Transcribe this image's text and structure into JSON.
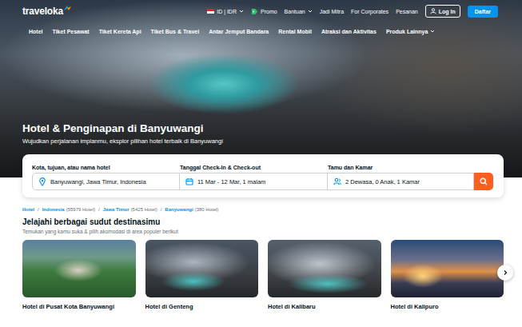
{
  "header": {
    "logo": "traveloka",
    "locale": "ID | IDR",
    "links": [
      {
        "label": "Promo",
        "kind": "promo"
      },
      {
        "label": "Bantuan",
        "kind": "dropdown"
      },
      {
        "label": "Jadi Mitra",
        "kind": "plain"
      },
      {
        "label": "For Corporates",
        "kind": "plain"
      },
      {
        "label": "Pesanan",
        "kind": "plain"
      }
    ],
    "login": "Log In",
    "register": "Daftar"
  },
  "nav": [
    {
      "label": "Hotel",
      "dropdown": false
    },
    {
      "label": "Tiket Pesawat",
      "dropdown": false
    },
    {
      "label": "Tiket Kereta Api",
      "dropdown": false
    },
    {
      "label": "Tiket Bus & Travel",
      "dropdown": false
    },
    {
      "label": "Antar Jemput Bandara",
      "dropdown": false
    },
    {
      "label": "Rental Mobil",
      "dropdown": false
    },
    {
      "label": "Atraksi dan Aktivitas",
      "dropdown": false
    },
    {
      "label": "Produk Lainnya",
      "dropdown": true
    }
  ],
  "hero": {
    "title": "Hotel & Penginapan di Banyuwangi",
    "subtitle": "Wujudkan perjalanan impianmu, eksplor pilihan hotel terbaik di Banyuwangi"
  },
  "search": {
    "fields": [
      {
        "label": "Kota, tujuan, atau nama hotel",
        "value": "Banyuwangi, Jawa Timur, Indonesia",
        "kind": "destination"
      },
      {
        "label": "Tanggal Check-In & Check-out",
        "value": "11 Mar - 12 Mar, 1 malam",
        "kind": "dates"
      },
      {
        "label": "Tamu dan Kamar",
        "value": "2 Dewasa, 0 Anak, 1 Kamar",
        "kind": "guests"
      }
    ]
  },
  "breadcrumb": {
    "separator": "/",
    "items": [
      {
        "label": "Hotel",
        "count": ""
      },
      {
        "label": "Indonesia",
        "count": "(55979 Hotel)"
      },
      {
        "label": "Jawa Timur",
        "count": "(5425 Hotel)"
      },
      {
        "label": "Banyuwangi",
        "count": "(380 Hotel)"
      }
    ]
  },
  "section": {
    "title": "Jelajahi berbagai sudut destinasimu",
    "subtitle": "Temukan yang kamu suka & pilih akomodasi di area populer berikut",
    "cards": [
      {
        "caption": "Hotel di Pusat Kota Banyuwangi"
      },
      {
        "caption": "Hotel di Genteng"
      },
      {
        "caption": "Hotel di Kalibaru"
      },
      {
        "caption": "Hotel di Kalipuro"
      }
    ]
  }
}
